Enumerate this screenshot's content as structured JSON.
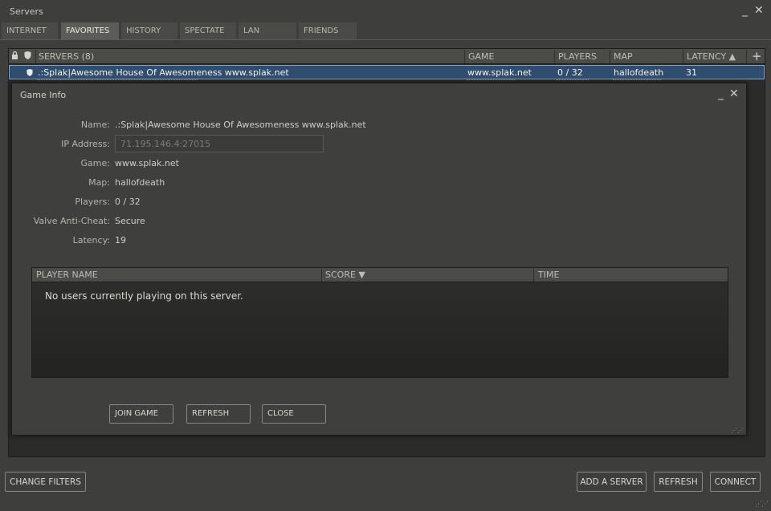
{
  "window": {
    "title": "Servers",
    "minimize_glyph": "_",
    "close_glyph": "✕"
  },
  "tabs": [
    {
      "label": "INTERNET",
      "active": false
    },
    {
      "label": "FAVORITES",
      "active": true
    },
    {
      "label": "HISTORY",
      "active": false
    },
    {
      "label": "SPECTATE",
      "active": false
    },
    {
      "label": "LAN",
      "active": false
    },
    {
      "label": "FRIENDS",
      "active": false
    }
  ],
  "server_list": {
    "columns": {
      "servers": "SERVERS (8)",
      "game": "GAME",
      "players": "PLAYERS",
      "map": "MAP",
      "latency": "LATENCY ▲"
    },
    "add_glyph": "+",
    "icons": [
      "lock-icon",
      "shield-icon"
    ],
    "selected_row": {
      "name": ".:Splak|Awesome House Of Awesomeness www.splak.net",
      "game": "www.splak.net",
      "players": "0 / 32",
      "map": "hallofdeath",
      "latency": "31"
    }
  },
  "bottom_buttons": {
    "change_filters": "CHANGE FILTERS",
    "add_server": "ADD A SERVER",
    "refresh": "REFRESH",
    "connect": "CONNECT"
  },
  "game_info": {
    "title": "Game Info",
    "labels": {
      "name": "Name:",
      "ip": "IP Address:",
      "game": "Game:",
      "map": "Map:",
      "players": "Players:",
      "vac": "Valve Anti-Cheat:",
      "latency": "Latency:"
    },
    "values": {
      "name": ".:Splak|Awesome House Of Awesomeness www.splak.net",
      "ip": "71.195.146.4:27015",
      "game": "www.splak.net",
      "map": "hallofdeath",
      "players": "0 / 32",
      "vac": "Secure",
      "latency": "19"
    },
    "player_table": {
      "col_name": "PLAYER NAME",
      "col_score": "SCORE ▼",
      "col_time": "TIME",
      "empty_text": "No users currently playing on this server."
    },
    "buttons": {
      "join": "JOIN GAME",
      "refresh": "REFRESH",
      "close": "CLOSE"
    }
  },
  "colors": {
    "background": "#3e3e3c",
    "selection": "#2f4d6e",
    "selection_border": "#88a3c2"
  }
}
